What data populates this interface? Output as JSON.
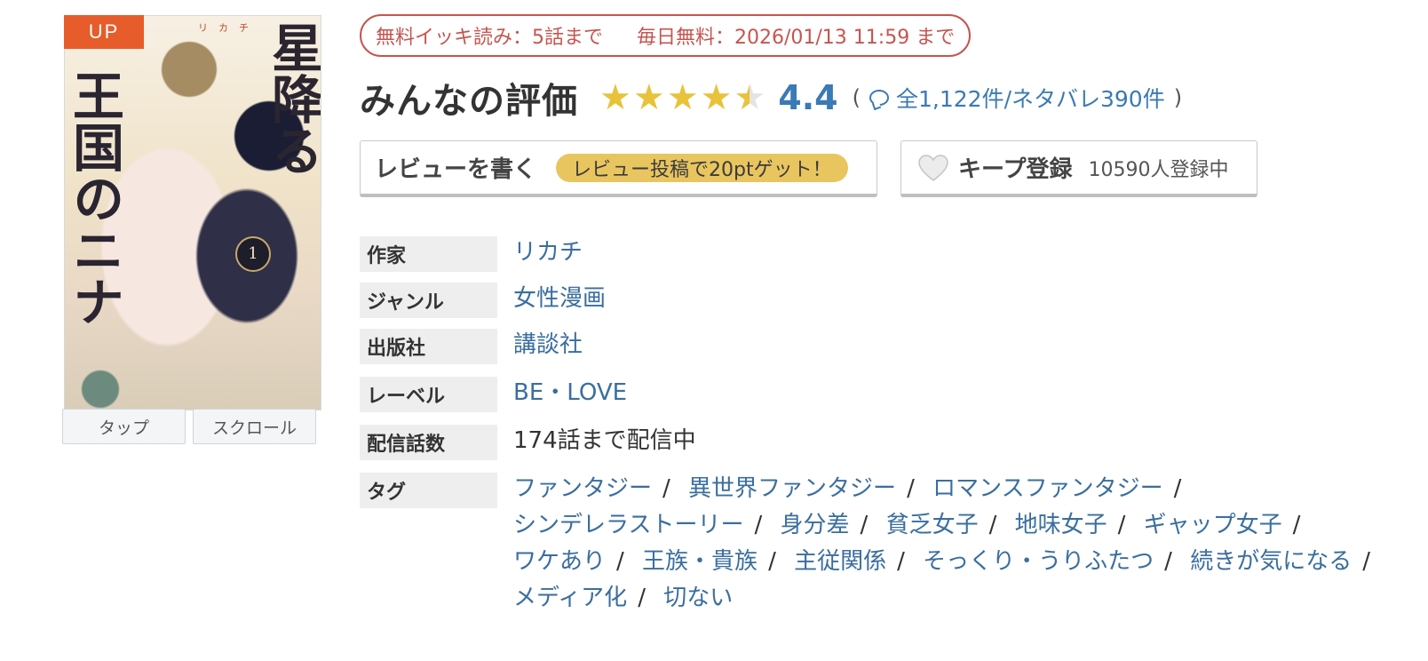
{
  "cover": {
    "badge": "UP",
    "title_line1": "星降る",
    "title_line2": "王国のニナ",
    "author_mark": "リカチ",
    "volume": "1"
  },
  "view_buttons": [
    "タップ",
    "スクロール"
  ],
  "free_info": {
    "ikki": "無料イッキ読み：5話まで",
    "daily": "毎日無料：2026/01/13 11:59 まで"
  },
  "rating": {
    "title": "みんなの評価",
    "score_text": "4.4",
    "score_value": 4.4,
    "open_paren": "(",
    "counts": "全1,122件/ネタバレ390件",
    "close_paren": ")",
    "star_color": "#e8c23a"
  },
  "review_button": {
    "label": "レビューを書く",
    "badge": "レビュー投稿で20ptゲット！"
  },
  "keep_button": {
    "label": "キープ登録",
    "count": "10590人登録中"
  },
  "info": {
    "author_label": "作家",
    "author": "リカチ",
    "genre_label": "ジャンル",
    "genre": "女性漫画",
    "publisher_label": "出版社",
    "publisher": "講談社",
    "label_label": "レーベル",
    "label": "BE・LOVE",
    "episodes_label": "配信話数",
    "episodes": "174話まで配信中",
    "tags_label": "タグ",
    "tags": [
      "ファンタジー",
      "異世界ファンタジー",
      "ロマンスファンタジー",
      "シンデレラストーリー",
      "身分差",
      "貧乏女子",
      "地味女子",
      "ギャップ女子",
      "ワケあり",
      "王族・貴族",
      "主従関係",
      "そっくり・うりふたつ",
      "続きが気になる",
      "メディア化",
      "切ない"
    ],
    "tag_separator": "/"
  },
  "colors": {
    "link": "#3a6e9f",
    "accent_red": "#c5554f",
    "badge_orange": "#e65c2b",
    "badge_yellow": "#e9c560"
  }
}
